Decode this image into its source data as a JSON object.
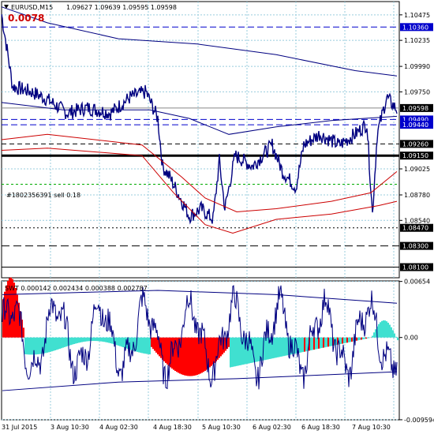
{
  "header": {
    "symbol_tf": "EURUSD,M15",
    "ohlc": "1.09627 1.09639 1.09595 1.09598",
    "profit": "0.0078"
  },
  "main": {
    "ylim": [
      1.08,
      1.106
    ],
    "price_ticks": [
      "1.10475",
      "1.10235",
      "1.09990",
      "1.09750",
      "1.09025",
      "1.08780",
      "1.08540"
    ],
    "badges": [
      {
        "label": "1.10360",
        "value": 1.1036,
        "fill": "#0000cc"
      },
      {
        "label": "1.09598",
        "value": 1.09598,
        "fill": "#000000"
      },
      {
        "label": "1.09490",
        "value": 1.0949,
        "fill": "#0000cc"
      },
      {
        "label": "1.09440",
        "value": 1.0944,
        "fill": "#0000cc"
      },
      {
        "label": "1.09260",
        "value": 1.0926,
        "fill": "#000000"
      },
      {
        "label": "1.09150",
        "value": 1.0915,
        "fill": "#000000"
      },
      {
        "label": "1.08470",
        "value": 1.0847,
        "fill": "#000000"
      },
      {
        "label": "1.08300",
        "value": 1.083,
        "fill": "#000000"
      },
      {
        "label": "1.08100",
        "value": 1.081,
        "fill": "#000000"
      }
    ],
    "order_label": "#1802356391 sell 0.18"
  },
  "indicator": {
    "header": "SWT 0.000142 0.002434 0.000388 0.002787",
    "ticks": [
      "0.00654",
      "0.00",
      "-0.009594"
    ],
    "ylim": [
      -0.0096,
      0.0066
    ]
  },
  "time_axis": [
    "31 Jul 2015",
    "3 Aug 10:30",
    "4 Aug 02:30",
    "4 Aug 18:30",
    "5 Aug 10:30",
    "6 Aug 02:30",
    "6 Aug 18:30",
    "7 Aug 10:30"
  ],
  "colors": {
    "price_line": "#000080",
    "ma_red": "#cc0000",
    "hist_red": "#ff0000",
    "hist_cyan": "#40e0d0",
    "grid": "#99ccdd"
  }
}
